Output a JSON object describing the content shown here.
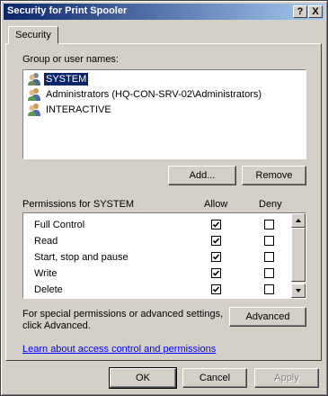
{
  "window": {
    "title": "Security for Print Spooler",
    "help_label": "?",
    "close_label": "X"
  },
  "tab": {
    "label": "Security"
  },
  "group_section": {
    "label": "Group or user names:",
    "items": [
      {
        "label": "SYSTEM",
        "selected": true
      },
      {
        "label": "Administrators (HQ-CON-SRV-02\\Administrators)",
        "selected": false
      },
      {
        "label": "INTERACTIVE",
        "selected": false
      }
    ],
    "add_label": "Add...",
    "remove_label": "Remove"
  },
  "permissions": {
    "header": "Permissions for SYSTEM",
    "allow_header": "Allow",
    "deny_header": "Deny",
    "rows": [
      {
        "name": "Full Control",
        "allow": true,
        "deny": false
      },
      {
        "name": "Read",
        "allow": true,
        "deny": false
      },
      {
        "name": "Start, stop and pause",
        "allow": true,
        "deny": false
      },
      {
        "name": "Write",
        "allow": true,
        "deny": false
      },
      {
        "name": "Delete",
        "allow": true,
        "deny": false
      }
    ]
  },
  "advanced": {
    "text_line1": "For special permissions or advanced settings,",
    "text_line2": "click Advanced.",
    "button_label": "Advanced"
  },
  "link_text": "Learn about access control and permissions",
  "footer": {
    "ok_label": "OK",
    "cancel_label": "Cancel",
    "apply_label": "Apply"
  },
  "colors": {
    "title_start": "#0a246a",
    "title_end": "#a6caf0",
    "face": "#d4d0c8",
    "selection": "#0a246a",
    "link": "#0000ff"
  }
}
